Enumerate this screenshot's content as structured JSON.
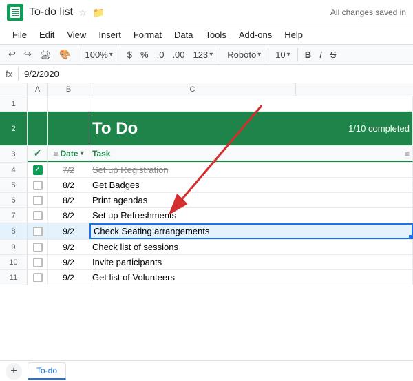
{
  "titleBar": {
    "title": "To-do list",
    "savedText": "All changes saved in"
  },
  "menuBar": {
    "items": [
      "File",
      "Edit",
      "View",
      "Insert",
      "Format",
      "Data",
      "Tools",
      "Add-ons",
      "Help"
    ]
  },
  "toolbar": {
    "zoom": "100%",
    "currency": "$",
    "percent": "%",
    "decimal1": ".0",
    "decimal2": ".00",
    "format123": "123",
    "font": "Roboto",
    "fontSize": "10",
    "boldLabel": "B",
    "italicLabel": "I",
    "strikeLabel": "S"
  },
  "formulaBar": {
    "cellRef": "9/2/2020",
    "fxLabel": "fx"
  },
  "colHeaders": [
    "",
    "A",
    "B",
    "C"
  ],
  "spreadsheet": {
    "headerRow": {
      "rowNum": "2",
      "title": "To Do",
      "completed": "1/10 completed"
    },
    "colNameRow": {
      "rowNum": "3",
      "checkmark": "✓",
      "date": "Date",
      "task": "Task"
    },
    "rows": [
      {
        "num": "4",
        "checked": true,
        "date": "7/2",
        "task": "Set up Registration",
        "completed": true
      },
      {
        "num": "5",
        "checked": false,
        "date": "8/2",
        "task": "Get Badges",
        "completed": false
      },
      {
        "num": "6",
        "checked": false,
        "date": "8/2",
        "task": "Print agendas",
        "completed": false
      },
      {
        "num": "7",
        "checked": false,
        "date": "8/2",
        "task": "Set up Refreshments",
        "completed": false
      },
      {
        "num": "8",
        "checked": false,
        "date": "9/2",
        "task": "Check Seating arrangements",
        "completed": false,
        "selected": true
      },
      {
        "num": "9",
        "checked": false,
        "date": "9/2",
        "task": "Check list of sessions",
        "completed": false
      },
      {
        "num": "10",
        "checked": false,
        "date": "9/2",
        "task": "Invite participants",
        "completed": false
      },
      {
        "num": "11",
        "checked": false,
        "date": "9/2",
        "task": "Get list of Volunteers",
        "completed": false
      }
    ]
  },
  "bottomBar": {
    "addLabel": "+",
    "tabs": [
      {
        "label": "To-do",
        "active": true
      }
    ]
  },
  "icons": {
    "star": "☆",
    "folder": "🗁",
    "undo": "↩",
    "redo": "↪",
    "print": "🖨",
    "paintFormat": "🖊",
    "chevronDown": "▾",
    "filterAsc": "≡",
    "sortIcon": "⇅"
  }
}
